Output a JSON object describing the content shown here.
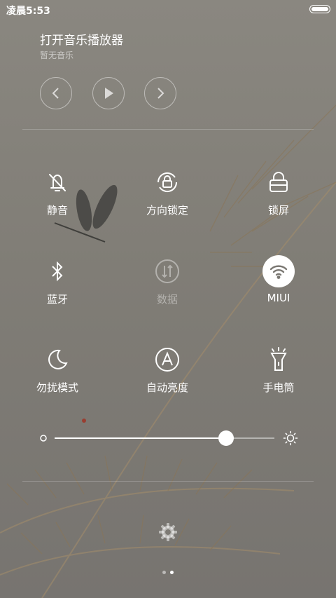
{
  "status_bar": {
    "time": "凌晨5:53"
  },
  "music": {
    "title": "打开音乐播放器",
    "subtitle": "暂无音乐"
  },
  "toggles": [
    {
      "label": "静音",
      "icon": "bell-off-icon"
    },
    {
      "label": "方向锁定",
      "icon": "rotation-lock-icon"
    },
    {
      "label": "锁屏",
      "icon": "lock-icon"
    },
    {
      "label": "蓝牙",
      "icon": "bluetooth-icon"
    },
    {
      "label": "数据",
      "icon": "mobile-data-icon",
      "state": "off"
    },
    {
      "label": "MIUI",
      "icon": "wifi-icon",
      "state": "on"
    },
    {
      "label": "勿扰模式",
      "icon": "moon-icon"
    },
    {
      "label": "自动亮度",
      "icon": "auto-brightness-icon"
    },
    {
      "label": "手电筒",
      "icon": "flashlight-icon"
    }
  ],
  "brightness": {
    "level": 0.78
  },
  "pager": {
    "pages": 2,
    "current": 2
  }
}
